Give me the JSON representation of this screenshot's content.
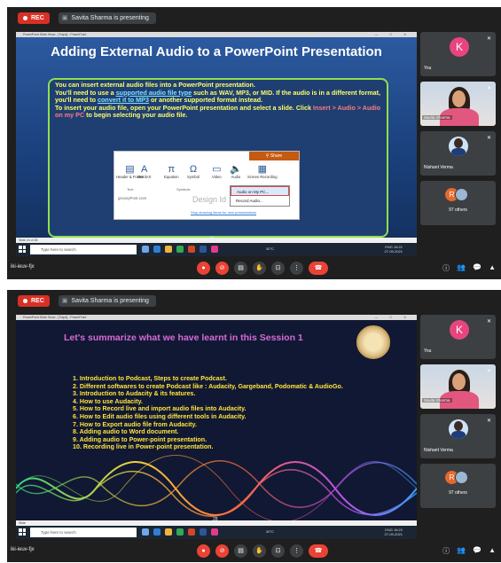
{
  "meeting": {
    "rec_label": "REC",
    "presenting_label": "Savita Sharma is presenting",
    "code": "iki-ieuv-fjx"
  },
  "ppt": {
    "window_title": "PowerPoint Slide Show - [Tutpd] - PowerPoint",
    "window_controls": "— ☐ ✕"
  },
  "slide1": {
    "title": "Adding External Audio to a PowerPoint Presentation",
    "text_parts": [
      "You can insert external audio files into a PowerPoint presentation.",
      "You'll need to use a",
      "supported audio file type",
      "such as WAV, MP3, or MID. If the audio is in a different format, you'll need to",
      "convert it to MP3",
      "or another supported format instead.",
      "To insert your audio file, open your PowerPoint presentation and select a slide. Click",
      "Insert > Audio > Audio on my PC",
      "to begin selecting your audio file."
    ],
    "ribbon": {
      "share": "Share",
      "tools": [
        "Header & Footer",
        "WordArt",
        "Equation",
        "Symbol",
        "Video",
        "Audio",
        "Screen Recording"
      ],
      "groups": [
        "Text",
        "Symbols"
      ],
      "site": "groovyPost.com",
      "design": "Design Id",
      "ideas_link": "Stop showing ideas for new presentations",
      "menu": [
        "Audio on My PC...",
        "Record Audio..."
      ]
    },
    "page_number": "24",
    "status": "Slide 24 of 28"
  },
  "slide2": {
    "title": "Let's summarize what we have learnt in this Session 1",
    "items": [
      "1.  Introduction to Podcast, Steps to create Podcast.",
      "2.  Different softwares to create Podcast like : Audacity, Gargeband, Podomatic & AudioGo.",
      "3.  Introduction to Audacity & its features.",
      "4.  How to use Audacity.",
      "5.  How to Record live and import audio files into Audacity.",
      "6.  How to Edit audio files using different tools in Audacity.",
      "7.  How to Export audio file from Audacity.",
      "8.  Adding audio to Word document.",
      "9.  Adding audio to Power-point presentation.",
      "10. Recording live in Power-point presentation."
    ],
    "page_number": "28",
    "status": "Slide"
  },
  "taskbar": {
    "search_placeholder": "Type here to search",
    "weather": "30°C",
    "lang": "ENG",
    "time1": "16:21",
    "date1": "27-09-2021",
    "time2": "16:22",
    "date2": "27-09-2021"
  },
  "participants": {
    "you_initial": "K",
    "you_label": "You",
    "savita_label": "Savita Sharma",
    "nishant_label": "Nishant Verma",
    "others_initial": "R",
    "others_label": "97 others"
  },
  "colors": {
    "rec": "#d93025",
    "avatar_k": "#e8457f",
    "end_call": "#ea4335",
    "slide2_title": "#d76ad6",
    "slide2_text": "#ffe53b",
    "slide1_text": "#ffff66"
  }
}
